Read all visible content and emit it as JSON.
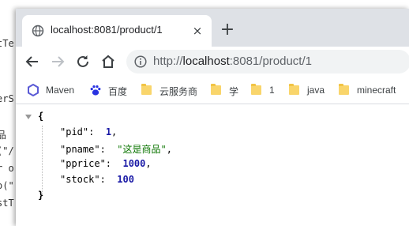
{
  "background_editor": {
    "lines": [
      "tTe",
      "erS",
      "品",
      "(\"/",
      "r o",
      "o(\"",
      "stT"
    ]
  },
  "tab": {
    "title": "localhost:8081/product/1",
    "close_glyph": "×"
  },
  "new_tab_glyph": "+",
  "address_bar": {
    "protocol": "http://",
    "host": "localhost",
    "path": ":8081/product/1"
  },
  "bookmarks": [
    {
      "label": "Maven",
      "icon": "maven-hexagon-icon"
    },
    {
      "label": "百度",
      "icon": "baidu-paw-icon"
    },
    {
      "label": "云服务商",
      "icon": "folder-icon"
    },
    {
      "label": "学",
      "icon": "folder-icon"
    },
    {
      "label": "1",
      "icon": "folder-icon"
    },
    {
      "label": "java",
      "icon": "folder-icon"
    },
    {
      "label": "minecraft",
      "icon": "folder-icon"
    }
  ],
  "json_view": {
    "open_brace": "{",
    "close_brace": "}",
    "fields": [
      {
        "key": "\"pid\"",
        "value": "1",
        "type": "number",
        "comma": ","
      },
      {
        "key": "\"pname\"",
        "value": "\"这是商品\"",
        "type": "string",
        "comma": ","
      },
      {
        "key": "\"pprice\"",
        "value": "1000",
        "type": "number",
        "comma": ","
      },
      {
        "key": "\"stock\"",
        "value": "100",
        "type": "number",
        "comma": ""
      }
    ]
  },
  "colors": {
    "tabstrip": "#dee1e6",
    "number": "#1a1aa6",
    "string": "#0b7500",
    "folder": "#f9d56b",
    "maven": "#5b5bd6",
    "baidu": "#2932e1"
  }
}
